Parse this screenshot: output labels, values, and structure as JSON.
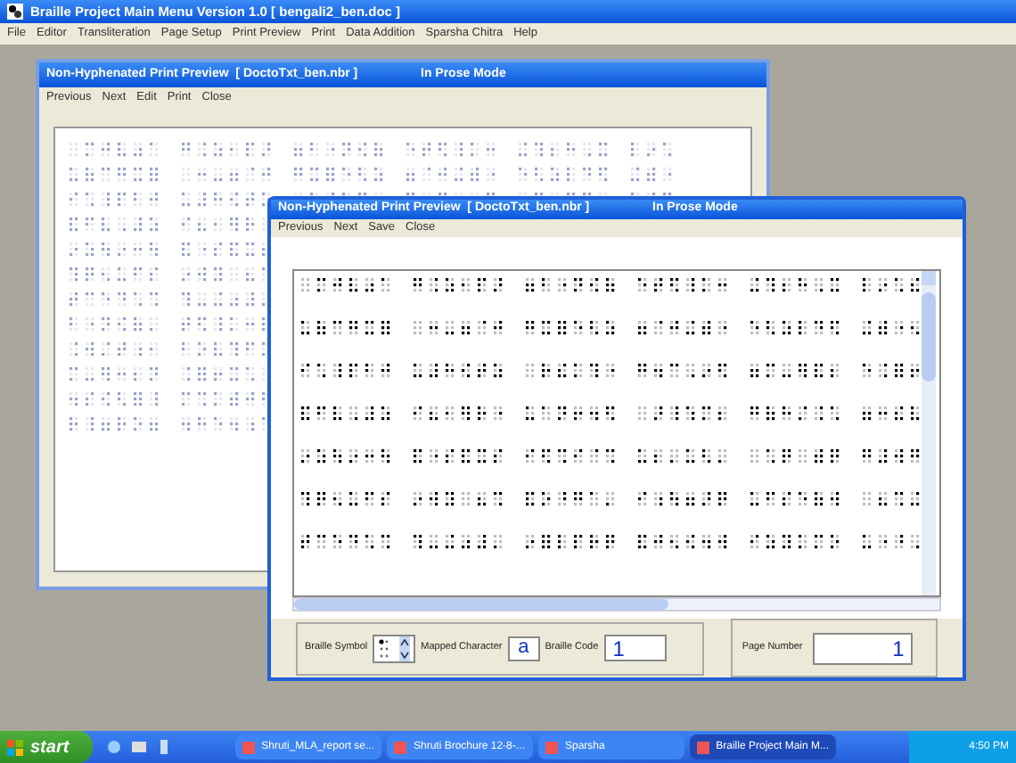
{
  "main_window": {
    "title": "Braille Project Main Menu Version 1.0 [ bengali2_ben.doc ]",
    "menu": [
      "File",
      "Editor",
      "Transliteration",
      "Page Setup",
      "Print Preview",
      "Print",
      "Data Addition",
      "Sparsha Chitra",
      "Help"
    ]
  },
  "back_preview": {
    "title": "Non-Hyphenated Print Preview  [ DoctoTxt_ben.nbr ]",
    "mode": "In Prose Mode",
    "menu": [
      "Previous",
      "Next",
      "Edit",
      "Print",
      "Close"
    ]
  },
  "front_preview": {
    "title": "Non-Hyphenated Print Preview  [ DoctoTxt_ben.nbr ]",
    "mode": "In Prose Mode",
    "menu": [
      "Previous",
      "Next",
      "Save",
      "Close"
    ],
    "braille_symbol_label": "Braille Symbol",
    "mapped_character_label": "Mapped Character",
    "mapped_character": "a",
    "braille_code_label": "Braille Code",
    "braille_code": "1",
    "page_number_label": "Page Number",
    "page_number": "1"
  },
  "taskbar": {
    "start": "start",
    "tasks": [
      {
        "label": "Shruti_MLA_report se...",
        "selected": false
      },
      {
        "label": "Shruti Brochure 12-8-...",
        "selected": false
      },
      {
        "label": "Sparsha",
        "selected": false
      },
      {
        "label": "Braille Project Main M...",
        "selected": true
      }
    ],
    "clock": "4:50 PM"
  }
}
